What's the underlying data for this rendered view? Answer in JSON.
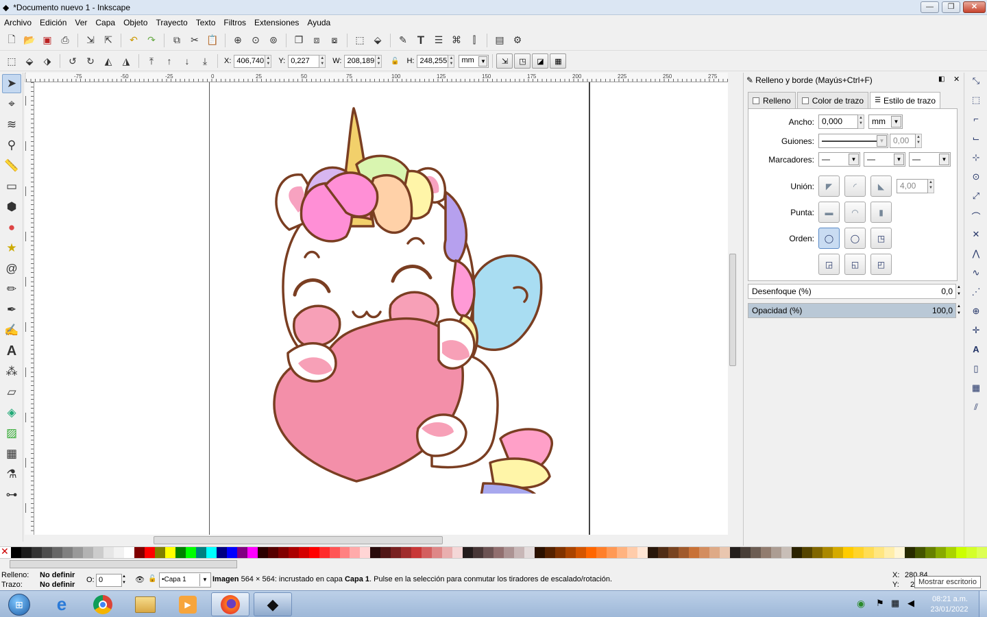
{
  "window": {
    "title": "*Documento nuevo 1 - Inkscape",
    "minimize": "—",
    "maximize": "❐",
    "close": "✕"
  },
  "menu": [
    "Archivo",
    "Edición",
    "Ver",
    "Capa",
    "Objeto",
    "Trayecto",
    "Texto",
    "Filtros",
    "Extensiones",
    "Ayuda"
  ],
  "toolbar2": {
    "x_label": "X:",
    "x": "406,740",
    "y_label": "Y:",
    "y": "0,227",
    "w_label": "W:",
    "w": "208,189",
    "h_label": "H:",
    "h": "248,255",
    "unit": "mm"
  },
  "ruler": {
    "h_ticks": [
      "-75",
      "-50",
      "-25",
      "0",
      "25",
      "50",
      "75",
      "100",
      "125",
      "150",
      "175",
      "200",
      "225",
      "250",
      "275"
    ]
  },
  "dock": {
    "title": "Relleno y borde (Mayús+Ctrl+F)",
    "tabs": [
      "Relleno",
      "Color de trazo",
      "Estilo de trazo"
    ],
    "selected_tab": "Estilo de trazo",
    "ancho_label": "Ancho:",
    "ancho": "0,000",
    "ancho_unit": "mm",
    "guiones_label": "Guiones:",
    "guiones_offset": "0,00",
    "marcadores_label": "Marcadores:",
    "union_label": "Unión:",
    "miter": "4,00",
    "punta_label": "Punta:",
    "orden_label": "Orden:",
    "blur_label": "Desenfoque (%)",
    "blur": "0,0",
    "opacity_label": "Opacidad (%)",
    "opacity": "100,0"
  },
  "status": {
    "fill_label": "Relleno:",
    "fill": "No definir",
    "stroke_label": "Trazo:",
    "stroke": "No definir",
    "o_label": "O:",
    "o": "0",
    "layer": "•Capa 1",
    "msg_bold1": "Imagen",
    "msg1": " 564 × 564: incrustado en capa ",
    "msg_bold2": "Capa 1",
    "msg2": ". Pulse en la selección para conmutar los tiradores de escalado/rotación.",
    "coord_x_label": "X:",
    "coord_x": "280,84",
    "coord_y_label": "Y:",
    "coord_y": "2",
    "tooltip": "Mostrar escritorio"
  },
  "clock": {
    "time": "08:21 a.m.",
    "date": "23/01/2022"
  },
  "colors": {
    "accent": "#c9dcf2",
    "heart": "#f38fa9",
    "hair_pink": "#ff8fd6",
    "outline": "#7a3e22"
  }
}
